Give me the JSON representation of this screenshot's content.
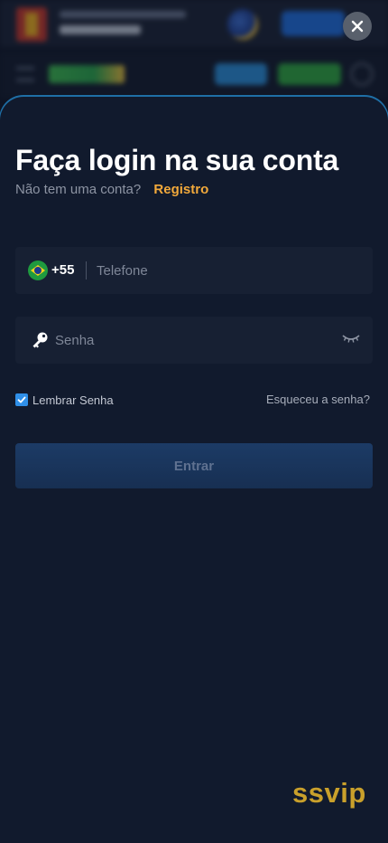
{
  "modal": {
    "title": "Faça login na sua conta",
    "subtitle": "Não tem uma conta?",
    "register_link": "Registro"
  },
  "phone_field": {
    "flag_icon": "brazil-flag-icon",
    "country_code": "+55",
    "placeholder": "Telefone",
    "value": ""
  },
  "password_field": {
    "icon": "key-icon",
    "placeholder": "Senha",
    "value": "",
    "toggle_icon": "eye-closed-icon"
  },
  "remember": {
    "label": "Lembrar Senha",
    "checked": true
  },
  "forgot_link": "Esqueceu a senha?",
  "submit_label": "Entrar",
  "close_icon": "close-icon",
  "watermark": "ssvip",
  "colors": {
    "accent": "#f2a93b",
    "checkbox": "#2f8fe8",
    "sheet_bg": "#111a2d",
    "field_bg": "#172033",
    "button_bg": "#1c3b66",
    "watermark": "#c9a02b"
  }
}
